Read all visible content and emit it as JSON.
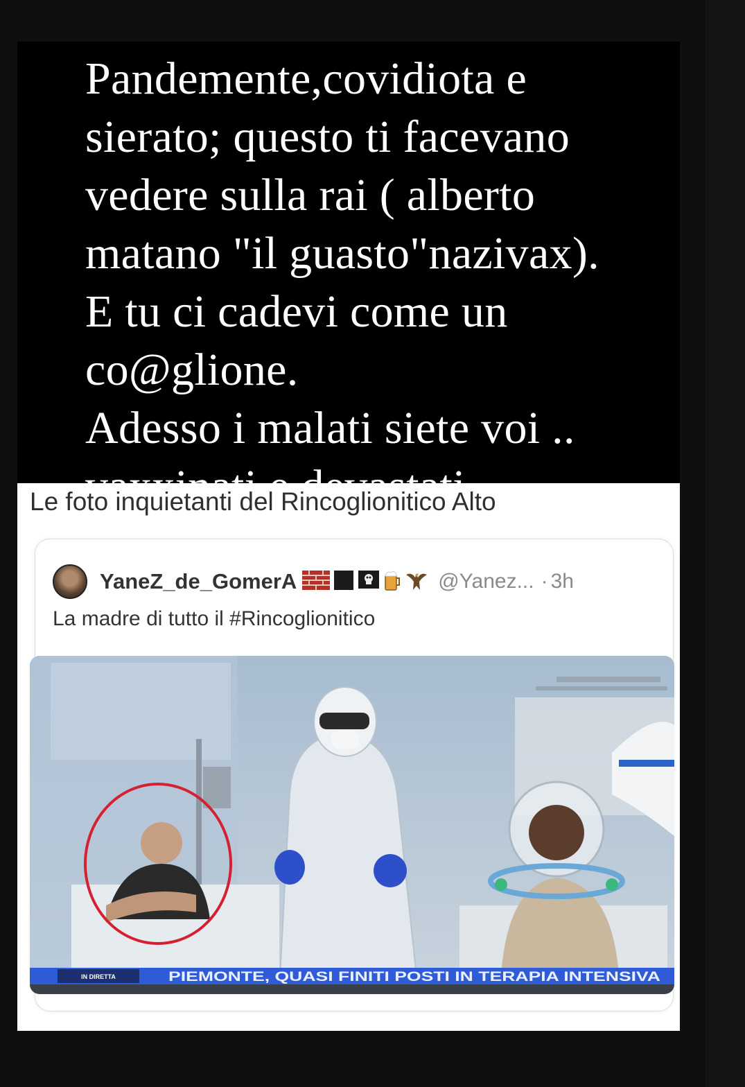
{
  "story": {
    "caption": "Pandemente,covidiota e\nsierato; questo ti facevano\nvedere sulla rai ( alberto\nmatano \"il guasto\"nazivax).\nE tu ci cadevi come un\nco@glione.\nAdesso i malati siete voi ..\nvaxxinati e devastati ..."
  },
  "post": {
    "headline": "Le foto inquietanti del Rincoglionitico Alto",
    "tweet": {
      "display_name": "YaneZ_de_GomerA",
      "handle": "@Yanez...",
      "separator": "·",
      "time": "3h",
      "text": "La madre di tutto il #Rincoglionitico",
      "name_emojis": [
        "brick-wall-icon",
        "black-square-icon",
        "pirate-flag-icon",
        "beer-mug-icon",
        "eagle-icon"
      ],
      "image": {
        "ticker_badge": "IN DIRETTA",
        "ticker_text": "PIEMONTE, QUASI FINITI POSTI IN TERAPIA INTENSIVA",
        "highlight_color": "#d42030"
      }
    }
  }
}
